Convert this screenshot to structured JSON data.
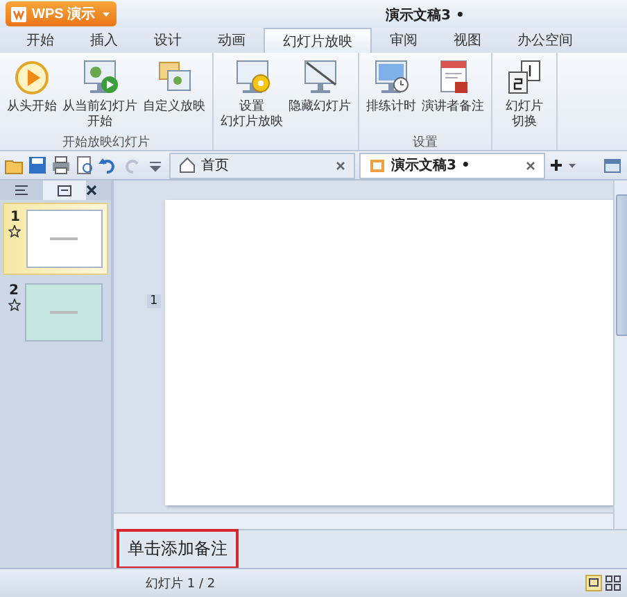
{
  "window": {
    "app_button": "WPS 演示",
    "title": "演示文稿3 •"
  },
  "ribbon_tabs": [
    {
      "label": "开始",
      "selected": false
    },
    {
      "label": "插入",
      "selected": false
    },
    {
      "label": "设计",
      "selected": false
    },
    {
      "label": "动画",
      "selected": false
    },
    {
      "label": "幻灯片放映",
      "selected": true
    },
    {
      "label": "审阅",
      "selected": false
    },
    {
      "label": "视图",
      "selected": false
    },
    {
      "label": "办公空间",
      "selected": false
    }
  ],
  "ribbon_groups": [
    {
      "label": "开始放映幻灯片",
      "buttons": [
        {
          "lines": [
            "从头开始"
          ],
          "kind": "play"
        },
        {
          "lines": [
            "从当前幻灯片",
            "开始"
          ],
          "kind": "current"
        },
        {
          "lines": [
            "自定义放映"
          ],
          "kind": "custom"
        }
      ]
    },
    {
      "buttons": [
        {
          "lines": [
            "设置",
            "幻灯片放映"
          ],
          "kind": "setup"
        },
        {
          "lines": [
            "隐藏幻灯片"
          ],
          "kind": "hide"
        }
      ]
    },
    {
      "label": "设置",
      "buttons": [
        {
          "lines": [
            "排练计时"
          ],
          "kind": "timer"
        },
        {
          "lines": [
            "演讲者备注"
          ],
          "kind": "notes"
        }
      ]
    },
    {
      "buttons": [
        {
          "lines": [
            "幻灯片",
            "切换"
          ],
          "kind": "switch"
        }
      ]
    }
  ],
  "doc_tabs": [
    {
      "label": "首页",
      "selected": false
    },
    {
      "label": "演示文稿3 •",
      "selected": true
    }
  ],
  "side_panel": {
    "tabs": [
      {
        "selected": false
      },
      {
        "selected": true
      }
    ],
    "slides": [
      {
        "number": "1",
        "selected": true,
        "color": "#ffffff"
      },
      {
        "number": "2",
        "selected": false,
        "color": "#c6e6e2"
      }
    ]
  },
  "editor": {
    "slide_marker": "1"
  },
  "notes": {
    "text": "单击添加备注",
    "highlighted": true
  },
  "status_bar": {
    "slide_counter": "幻灯片 1 / 2"
  }
}
